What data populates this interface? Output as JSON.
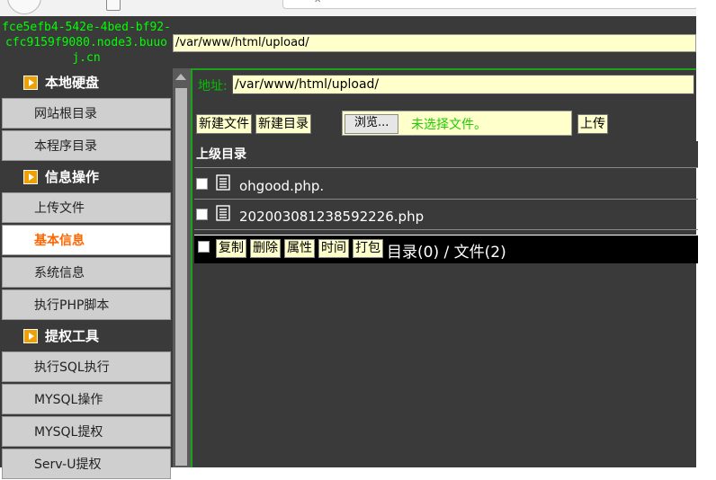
{
  "host": {
    "text": "fce5efb4-542e-4bed-bf92-cfc9159f9080.node3.buuoj.cn"
  },
  "top_path": "/var/www/html/upload/",
  "sidebar": {
    "sections": [
      {
        "title": "本地硬盘",
        "items": [
          "网站根目录",
          "本程序目录"
        ]
      },
      {
        "title": "信息操作",
        "items": [
          "上传文件",
          "基本信息",
          "系统信息",
          "执行PHP脚本"
        ]
      },
      {
        "title": "提权工具",
        "items": [
          "执行SQL执行",
          "MYSQL操作",
          "MYSQL提权",
          "Serv-U提权"
        ]
      }
    ],
    "active_item": "基本信息"
  },
  "content": {
    "address_label": "地址:",
    "address_value": "/var/www/html/upload/",
    "new_file_button": "新建文件",
    "new_dir_button": "新建目录",
    "browse_button": "浏览...",
    "no_file_selected": "未选择文件。",
    "upload_button": "上传",
    "parent_dir": "上级目录",
    "files": [
      {
        "name": "ohgood.php."
      },
      {
        "name": "202003081238592226.php"
      }
    ],
    "actions": {
      "copy": "复制",
      "delete": "删除",
      "attributes": "属性",
      "time": "时间",
      "pack": "打包",
      "summary": "目录(0) / 文件(2)"
    }
  },
  "colors": {
    "background": "#3a3a3a",
    "accent_green": "#00ff00",
    "input_bg": "#ffffcc",
    "active_text": "#ff6600"
  }
}
